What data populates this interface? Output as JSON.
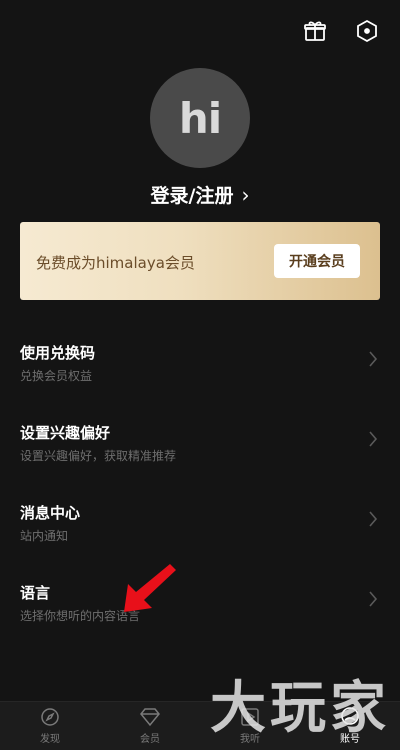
{
  "header": {
    "icons": [
      "gift-icon",
      "settings-hexagon-icon"
    ]
  },
  "profile": {
    "avatar_text": "hi",
    "login_label": "登录/注册",
    "chevron": "›"
  },
  "vip": {
    "text": "免费成为himalaya会员",
    "button_label": "开通会员"
  },
  "menu": {
    "items": [
      {
        "title": "使用兑换码",
        "subtitle": "兑换会员权益"
      },
      {
        "title": "设置兴趣偏好",
        "subtitle": "设置兴趣偏好，获取精准推荐"
      },
      {
        "title": "消息中心",
        "subtitle": "站内通知"
      },
      {
        "title": "语言",
        "subtitle": "选择你想听的内容语言"
      }
    ]
  },
  "tabbar": {
    "tabs": [
      {
        "label": "发现",
        "icon": "compass-icon"
      },
      {
        "label": "会员",
        "icon": "diamond-icon"
      },
      {
        "label": "我听",
        "icon": "play-icon"
      },
      {
        "label": "账号",
        "icon": "account-icon",
        "active": true
      }
    ]
  },
  "watermark": "大玩家",
  "colors": {
    "background": "#141414",
    "vip_gold": "#dcc08f",
    "annotation_arrow": "#e8101a"
  }
}
